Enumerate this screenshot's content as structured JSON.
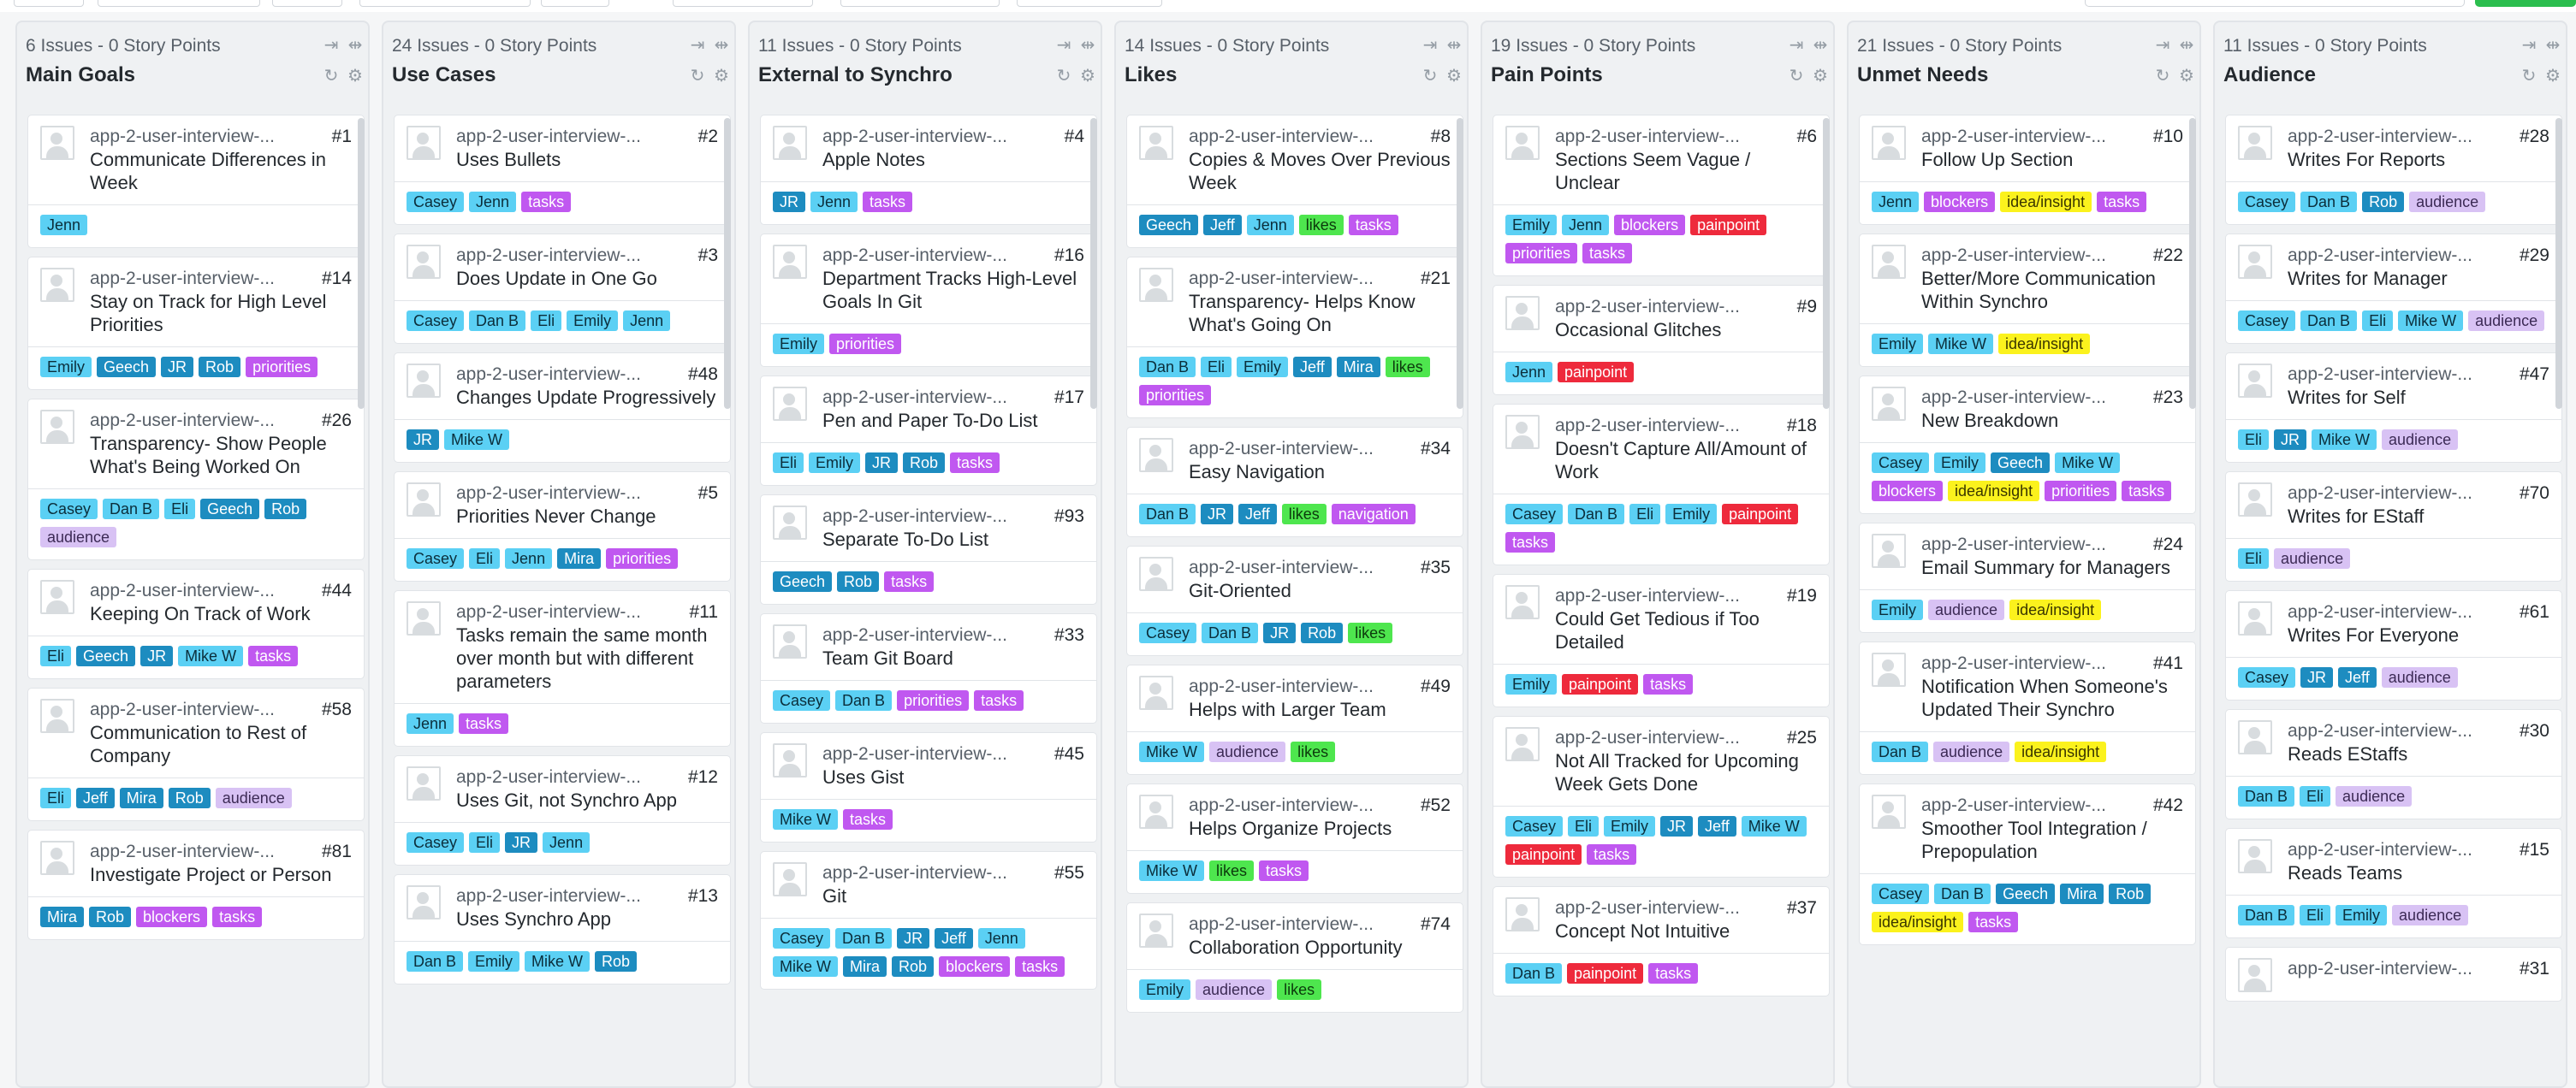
{
  "repo": "app-2-user-interview-...",
  "labelColors": {
    "Jenn": [
      "#5bd0f4",
      "#0b2e3b"
    ],
    "Casey": [
      "#5bd0f4",
      "#0b2e3b"
    ],
    "Emily": [
      "#5bd0f4",
      "#0b2e3b"
    ],
    "Eli": [
      "#5bd0f4",
      "#0b2e3b"
    ],
    "Dan B": [
      "#5bd0f4",
      "#0b2e3b"
    ],
    "Mike W": [
      "#5bd0f4",
      "#0b2e3b"
    ],
    "Jeff": [
      "#1d8cc0",
      "#ffffff"
    ],
    "Geech": [
      "#1d8cc0",
      "#ffffff"
    ],
    "JR": [
      "#1d8cc0",
      "#ffffff"
    ],
    "Rob": [
      "#1d8cc0",
      "#ffffff"
    ],
    "Mira": [
      "#1d8cc0",
      "#ffffff"
    ],
    "tasks": [
      "#c058f0",
      "#ffffff"
    ],
    "priorities": [
      "#c058f0",
      "#ffffff"
    ],
    "blockers": [
      "#c058f0",
      "#ffffff"
    ],
    "navigation": [
      "#c058f0",
      "#ffffff"
    ],
    "audience": [
      "#d8c2f4",
      "#3c2a55"
    ],
    "likes": [
      "#4ee64e",
      "#0c3a0c"
    ],
    "painpoint": [
      "#ee2a3c",
      "#ffffff"
    ],
    "idea/insight": [
      "#fbf21d",
      "#3a3600"
    ]
  },
  "columns": [
    {
      "count": "6 Issues",
      "points": " - 0 Story Points",
      "title": "Main Goals",
      "cards": [
        {
          "num": "#1",
          "title": "Communicate Differences in Week",
          "labels": [
            "Jenn"
          ]
        },
        {
          "num": "#14",
          "title": "Stay on Track for High Level Priorities",
          "labels": [
            "Emily",
            "Geech",
            "JR",
            "Rob",
            "priorities"
          ]
        },
        {
          "num": "#26",
          "title": "Transparency- Show People What's Being Worked On",
          "labels": [
            "Casey",
            "Dan B",
            "Eli",
            "Geech",
            "Rob",
            "audience"
          ]
        },
        {
          "num": "#44",
          "title": "Keeping On Track of Work",
          "labels": [
            "Eli",
            "Geech",
            "JR",
            "Mike W",
            "tasks"
          ]
        },
        {
          "num": "#58",
          "title": "Communication to Rest of Company",
          "labels": [
            "Eli",
            "Jeff",
            "Mira",
            "Rob",
            "audience"
          ]
        },
        {
          "num": "#81",
          "title": "Investigate Project or Person",
          "labels": [
            "Mira",
            "Rob",
            "blockers",
            "tasks"
          ]
        }
      ]
    },
    {
      "count": "24 Issues",
      "points": " - 0 Story Points",
      "title": "Use Cases",
      "cards": [
        {
          "num": "#2",
          "title": "Uses Bullets",
          "labels": [
            "Casey",
            "Jenn",
            "tasks"
          ]
        },
        {
          "num": "#3",
          "title": "Does Update in One Go",
          "labels": [
            "Casey",
            "Dan B",
            "Eli",
            "Emily",
            "Jenn"
          ]
        },
        {
          "num": "#48",
          "title": "Changes Update Progressively",
          "labels": [
            "JR",
            "Mike W"
          ]
        },
        {
          "num": "#5",
          "title": "Priorities Never Change",
          "labels": [
            "Casey",
            "Eli",
            "Jenn",
            "Mira",
            "priorities"
          ]
        },
        {
          "num": "#11",
          "title": "Tasks remain the same month over month but with different parameters",
          "labels": [
            "Jenn",
            "tasks"
          ]
        },
        {
          "num": "#12",
          "title": "Uses Git, not Synchro App",
          "labels": [
            "Casey",
            "Eli",
            "JR",
            "Jenn"
          ]
        },
        {
          "num": "#13",
          "title": "Uses Synchro App",
          "labels": [
            "Dan B",
            "Emily",
            "Mike W",
            "Rob"
          ]
        }
      ]
    },
    {
      "count": "11 Issues",
      "points": " - 0 Story Points",
      "title": "External to Synchro",
      "cards": [
        {
          "num": "#4",
          "title": "Apple Notes",
          "labels": [
            "JR",
            "Jenn",
            "tasks"
          ]
        },
        {
          "num": "#16",
          "title": "Department Tracks High-Level Goals In Git",
          "labels": [
            "Emily",
            "priorities"
          ]
        },
        {
          "num": "#17",
          "title": "Pen and Paper To-Do List",
          "labels": [
            "Eli",
            "Emily",
            "JR",
            "Rob",
            "tasks"
          ]
        },
        {
          "num": "#93",
          "title": "Separate To-Do List",
          "labels": [
            "Geech",
            "Rob",
            "tasks"
          ]
        },
        {
          "num": "#33",
          "title": "Team Git Board",
          "labels": [
            "Casey",
            "Dan B",
            "priorities",
            "tasks"
          ]
        },
        {
          "num": "#45",
          "title": "Uses Gist",
          "labels": [
            "Mike W",
            "tasks"
          ]
        },
        {
          "num": "#55",
          "title": "Git",
          "labels": [
            "Casey",
            "Dan B",
            "JR",
            "Jeff",
            "Jenn",
            "Mike W",
            "Mira",
            "Rob",
            "blockers",
            "tasks"
          ]
        }
      ]
    },
    {
      "count": "14 Issues",
      "points": " - 0 Story Points",
      "title": "Likes",
      "cards": [
        {
          "num": "#8",
          "title": "Copies & Moves Over Previous Week",
          "labels": [
            "Geech",
            "Jeff",
            "Jenn",
            "likes",
            "tasks"
          ]
        },
        {
          "num": "#21",
          "title": "Transparency- Helps Know What's Going On",
          "labels": [
            "Dan B",
            "Eli",
            "Emily",
            "Jeff",
            "Mira",
            "likes",
            "priorities"
          ]
        },
        {
          "num": "#34",
          "title": "Easy Navigation",
          "labels": [
            "Dan B",
            "JR",
            "Jeff",
            "likes",
            "navigation"
          ]
        },
        {
          "num": "#35",
          "title": "Git-Oriented",
          "labels": [
            "Casey",
            "Dan B",
            "JR",
            "Rob",
            "likes"
          ]
        },
        {
          "num": "#49",
          "title": "Helps with Larger Team",
          "labels": [
            "Mike W",
            "audience",
            "likes"
          ]
        },
        {
          "num": "#52",
          "title": "Helps Organize Projects",
          "labels": [
            "Mike W",
            "likes",
            "tasks"
          ]
        },
        {
          "num": "#74",
          "title": "Collaboration Opportunity",
          "labels": [
            "Emily",
            "audience",
            "likes"
          ]
        }
      ]
    },
    {
      "count": "19 Issues",
      "points": " - 0 Story Points",
      "title": "Pain Points",
      "cards": [
        {
          "num": "#6",
          "title": "Sections Seem Vague / Unclear",
          "labels": [
            "Emily",
            "Jenn",
            "blockers",
            "painpoint",
            "priorities",
            "tasks"
          ]
        },
        {
          "num": "#9",
          "title": "Occasional Glitches",
          "labels": [
            "Jenn",
            "painpoint"
          ]
        },
        {
          "num": "#18",
          "title": "Doesn't Capture All/Amount of Work",
          "labels": [
            "Casey",
            "Dan B",
            "Eli",
            "Emily",
            "painpoint",
            "tasks"
          ]
        },
        {
          "num": "#19",
          "title": "Could Get Tedious if Too Detailed",
          "labels": [
            "Emily",
            "painpoint",
            "tasks"
          ]
        },
        {
          "num": "#25",
          "title": "Not All Tracked for Upcoming Week Gets Done",
          "labels": [
            "Casey",
            "Eli",
            "Emily",
            "JR",
            "Jeff",
            "Mike W",
            "painpoint",
            "tasks"
          ]
        },
        {
          "num": "#37",
          "title": "Concept Not Intuitive",
          "labels": [
            "Dan B",
            "painpoint",
            "tasks"
          ]
        }
      ]
    },
    {
      "count": "21 Issues",
      "points": " - 0 Story Points",
      "title": "Unmet Needs",
      "cards": [
        {
          "num": "#10",
          "title": "Follow Up Section",
          "labels": [
            "Jenn",
            "blockers",
            "idea/insight",
            "tasks"
          ]
        },
        {
          "num": "#22",
          "title": "Better/More Communication Within Synchro",
          "labels": [
            "Emily",
            "Mike W",
            "idea/insight"
          ]
        },
        {
          "num": "#23",
          "title": "New Breakdown",
          "labels": [
            "Casey",
            "Emily",
            "Geech",
            "Mike W",
            "blockers",
            "idea/insight",
            "priorities",
            "tasks"
          ]
        },
        {
          "num": "#24",
          "title": "Email Summary for Managers",
          "labels": [
            "Emily",
            "audience",
            "idea/insight"
          ]
        },
        {
          "num": "#41",
          "title": "Notification When Someone's Updated Their Synchro",
          "labels": [
            "Dan B",
            "audience",
            "idea/insight"
          ]
        },
        {
          "num": "#42",
          "title": "Smoother Tool Integration / Prepopulation",
          "labels": [
            "Casey",
            "Dan B",
            "Geech",
            "Mira",
            "Rob",
            "idea/insight",
            "tasks"
          ]
        }
      ]
    },
    {
      "count": "11 Issues",
      "points": " - 0 Story Points",
      "title": "Audience",
      "cards": [
        {
          "num": "#28",
          "title": "Writes For Reports",
          "labels": [
            "Casey",
            "Dan B",
            "Rob",
            "audience"
          ]
        },
        {
          "num": "#29",
          "title": "Writes for Manager",
          "labels": [
            "Casey",
            "Dan B",
            "Eli",
            "Mike W",
            "audience"
          ]
        },
        {
          "num": "#47",
          "title": "Writes for Self",
          "labels": [
            "Eli",
            "JR",
            "Mike W",
            "audience"
          ]
        },
        {
          "num": "#70",
          "title": "Writes for EStaff",
          "labels": [
            "Eli",
            "audience"
          ]
        },
        {
          "num": "#61",
          "title": "Writes For Everyone",
          "labels": [
            "Casey",
            "JR",
            "Jeff",
            "audience"
          ]
        },
        {
          "num": "#30",
          "title": "Reads EStaffs",
          "labels": [
            "Dan B",
            "Eli",
            "audience"
          ]
        },
        {
          "num": "#15",
          "title": "Reads Teams",
          "labels": [
            "Dan B",
            "Eli",
            "Emily",
            "audience"
          ]
        },
        {
          "num": "#31",
          "title": "",
          "labels": []
        }
      ]
    }
  ]
}
